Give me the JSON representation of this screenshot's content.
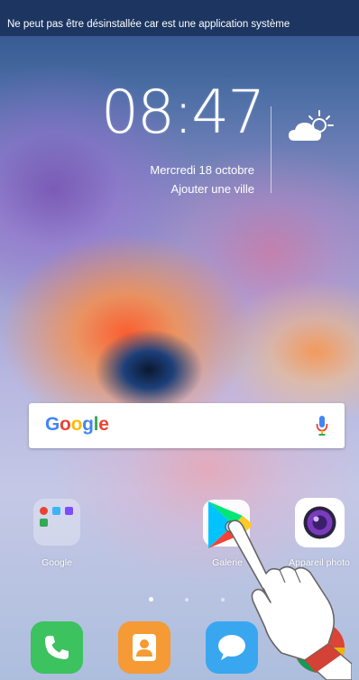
{
  "status": {
    "toast": "Ne peut pas être désinstallée car est une application système"
  },
  "clock_widget": {
    "time": "08:47",
    "date": "Mercredi 18 octobre",
    "add_city": "Ajouter une ville",
    "weather_icon": "partly-sunny-icon"
  },
  "search_bar": {
    "logo": "Google",
    "mic_icon": "microphone-icon"
  },
  "apps": [
    {
      "label": "Google",
      "icon": "google-folder-icon"
    },
    {
      "label": "Galerie",
      "icon": "play-store-icon"
    },
    {
      "label": "Appareil photo",
      "icon": "camera-icon"
    }
  ],
  "page_indicator": {
    "pages": 4,
    "current": 1
  },
  "dock": [
    {
      "icon": "phone-icon",
      "color": "#3cc25f"
    },
    {
      "icon": "contacts-icon",
      "color": "#f59a34"
    },
    {
      "icon": "messages-icon",
      "color": "#38a7ef"
    },
    {
      "icon": "chrome-icon",
      "color": "#db4437"
    }
  ],
  "overlay": {
    "gesture": "hand-pointer-icon"
  }
}
